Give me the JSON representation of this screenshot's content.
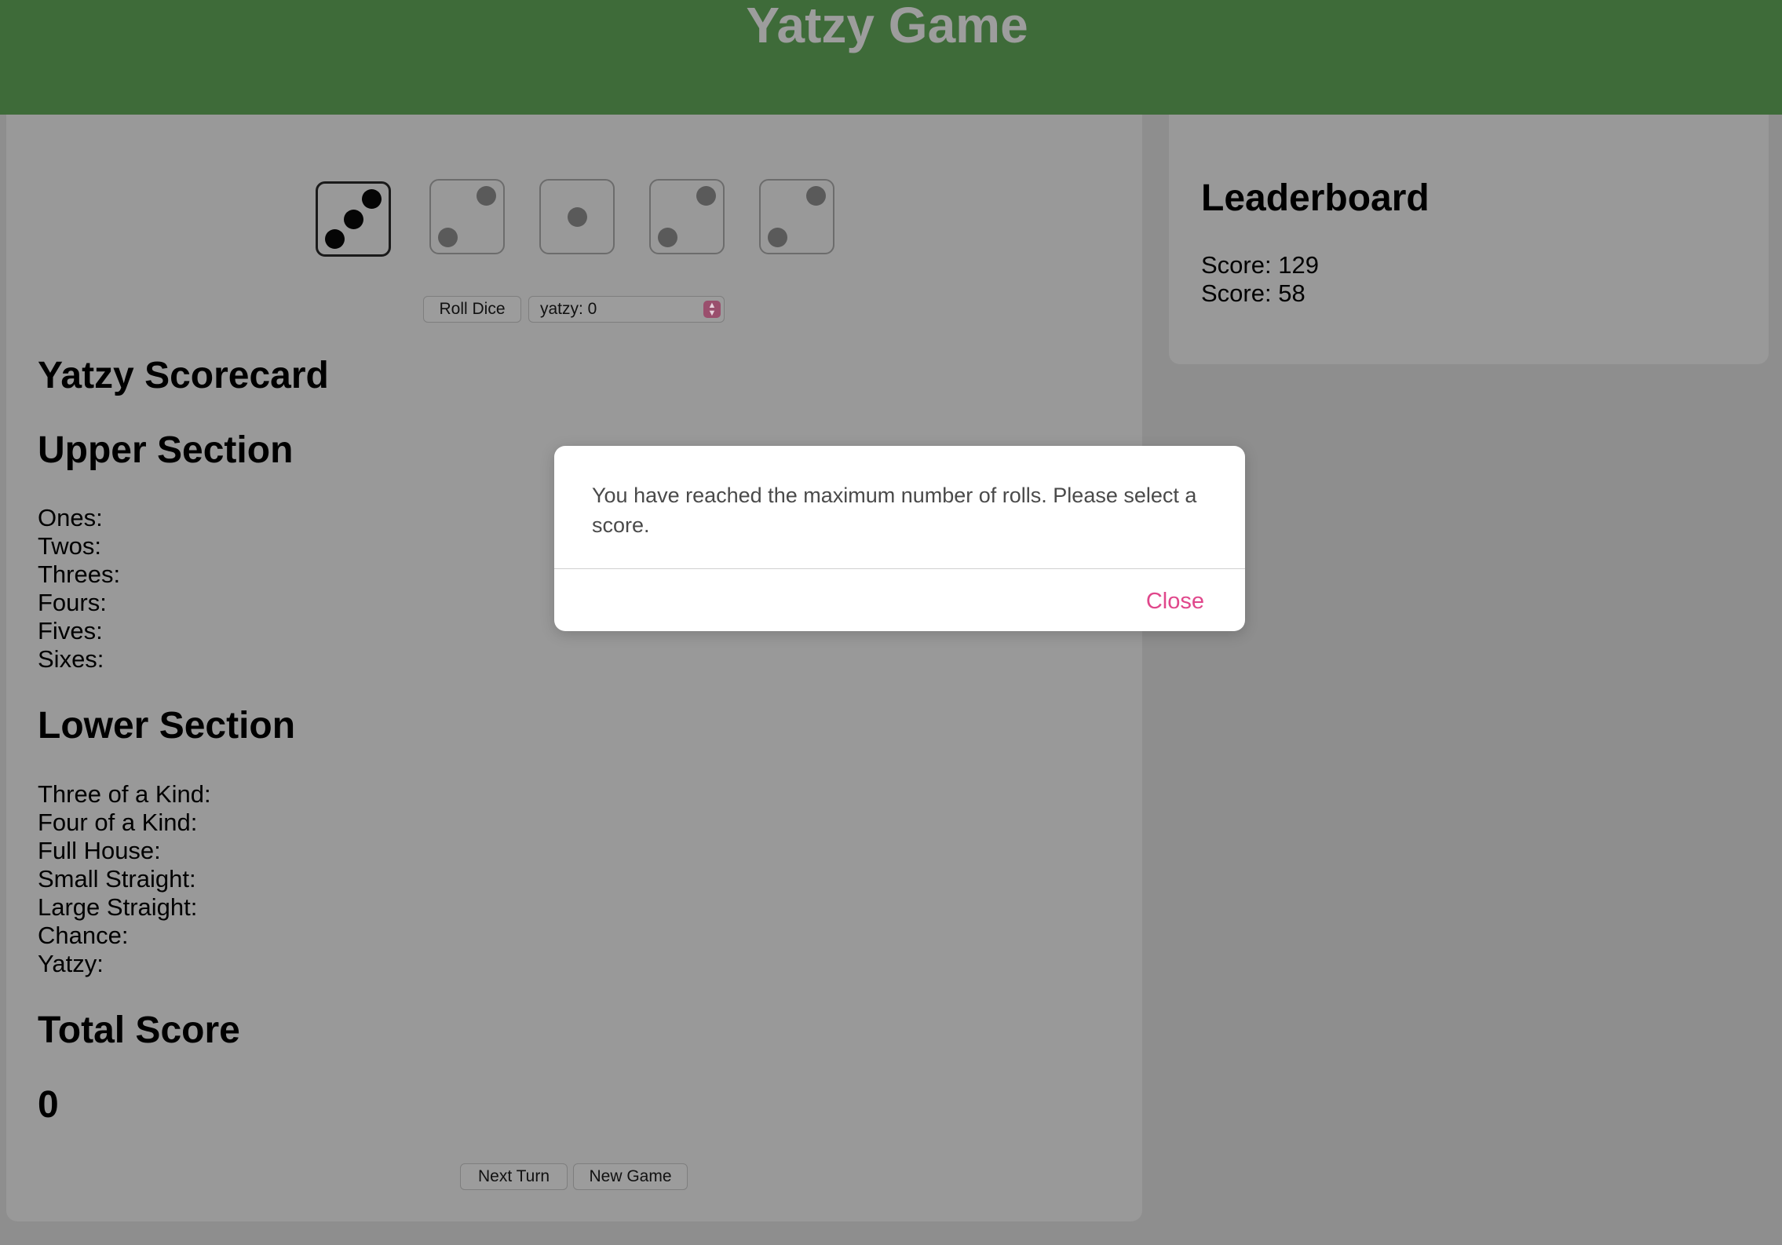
{
  "app": {
    "title": "Yatzy Game"
  },
  "dice": [
    {
      "value": 3,
      "held": true
    },
    {
      "value": 2,
      "held": false
    },
    {
      "value": 1,
      "held": false
    },
    {
      "value": 2,
      "held": false
    },
    {
      "value": 2,
      "held": false
    }
  ],
  "controls": {
    "roll_label": "Roll Dice",
    "category_select": "yatzy: 0",
    "next_turn_label": "Next Turn",
    "new_game_label": "New Game"
  },
  "scorecard": {
    "title": "Yatzy Scorecard",
    "upper": {
      "title": "Upper Section",
      "rows": [
        "Ones:",
        "Twos:",
        "Threes:",
        "Fours:",
        "Fives:",
        "Sixes:"
      ]
    },
    "lower": {
      "title": "Lower Section",
      "rows": [
        "Three of a Kind:",
        "Four of a Kind:",
        "Full House:",
        "Small Straight:",
        "Large Straight:",
        "Chance:",
        "Yatzy:"
      ]
    },
    "total": {
      "title": "Total Score",
      "value": "0"
    }
  },
  "leaderboard": {
    "title": "Leaderboard",
    "scores": [
      "Score: 129",
      "Score: 58"
    ]
  },
  "modal": {
    "message": "You have reached the maximum number of rolls. Please select a score.",
    "close_label": "Close"
  },
  "colors": {
    "header": "#3e6b39",
    "overlay_bg": "#8e8e8e",
    "accent": "#e0478b"
  }
}
